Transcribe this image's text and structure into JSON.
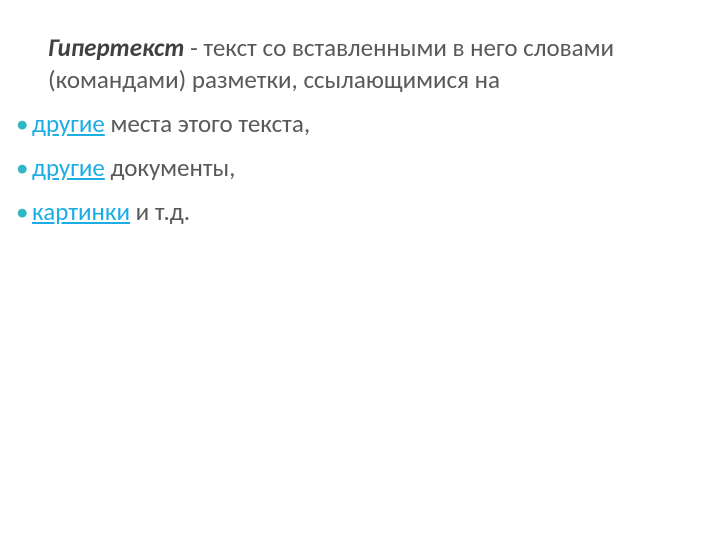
{
  "intro": {
    "term": "Гипертекст",
    "definition": " - текст со вставленными в него словами (командами) разметки, ссылающимися на"
  },
  "items": [
    {
      "link": "другие",
      "rest": " места этого текста,"
    },
    {
      "link": "другие",
      "rest": " документы,"
    },
    {
      "link": "картинки",
      "rest": " и т.д."
    }
  ]
}
